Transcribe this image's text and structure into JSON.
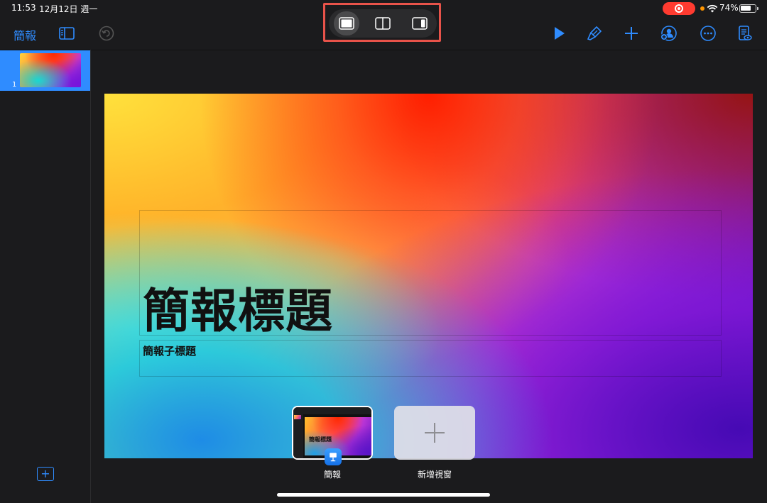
{
  "status_bar": {
    "time": "11:53",
    "date": "12月12日 週一",
    "battery_percent": "74%",
    "battery_level": 0.74,
    "recording_color": "#ff3b30"
  },
  "toolbar": {
    "back_label": "簡報",
    "accent_color": "#2f8cff",
    "left_icons": [
      "sidebar-toggle-icon",
      "undo-icon"
    ],
    "right_icons": [
      "play-icon",
      "format-brush-icon",
      "add-icon",
      "collaborate-icon",
      "more-icon",
      "presenter-notes-icon"
    ]
  },
  "window_modes": {
    "options": [
      "full-screen",
      "split-view",
      "slide-over"
    ],
    "selected": "full-screen",
    "highlight_color": "#e8534a"
  },
  "sidebar": {
    "slides": [
      {
        "number": "1"
      }
    ],
    "add_slide_icon": "add-slide-icon"
  },
  "slide": {
    "title": "簡報標題",
    "subtitle": "簡報子標題"
  },
  "window_shelf": {
    "current_window_label": "簡報",
    "current_window_preview_title": "簡報標題",
    "new_window_label": "新增視窗"
  }
}
